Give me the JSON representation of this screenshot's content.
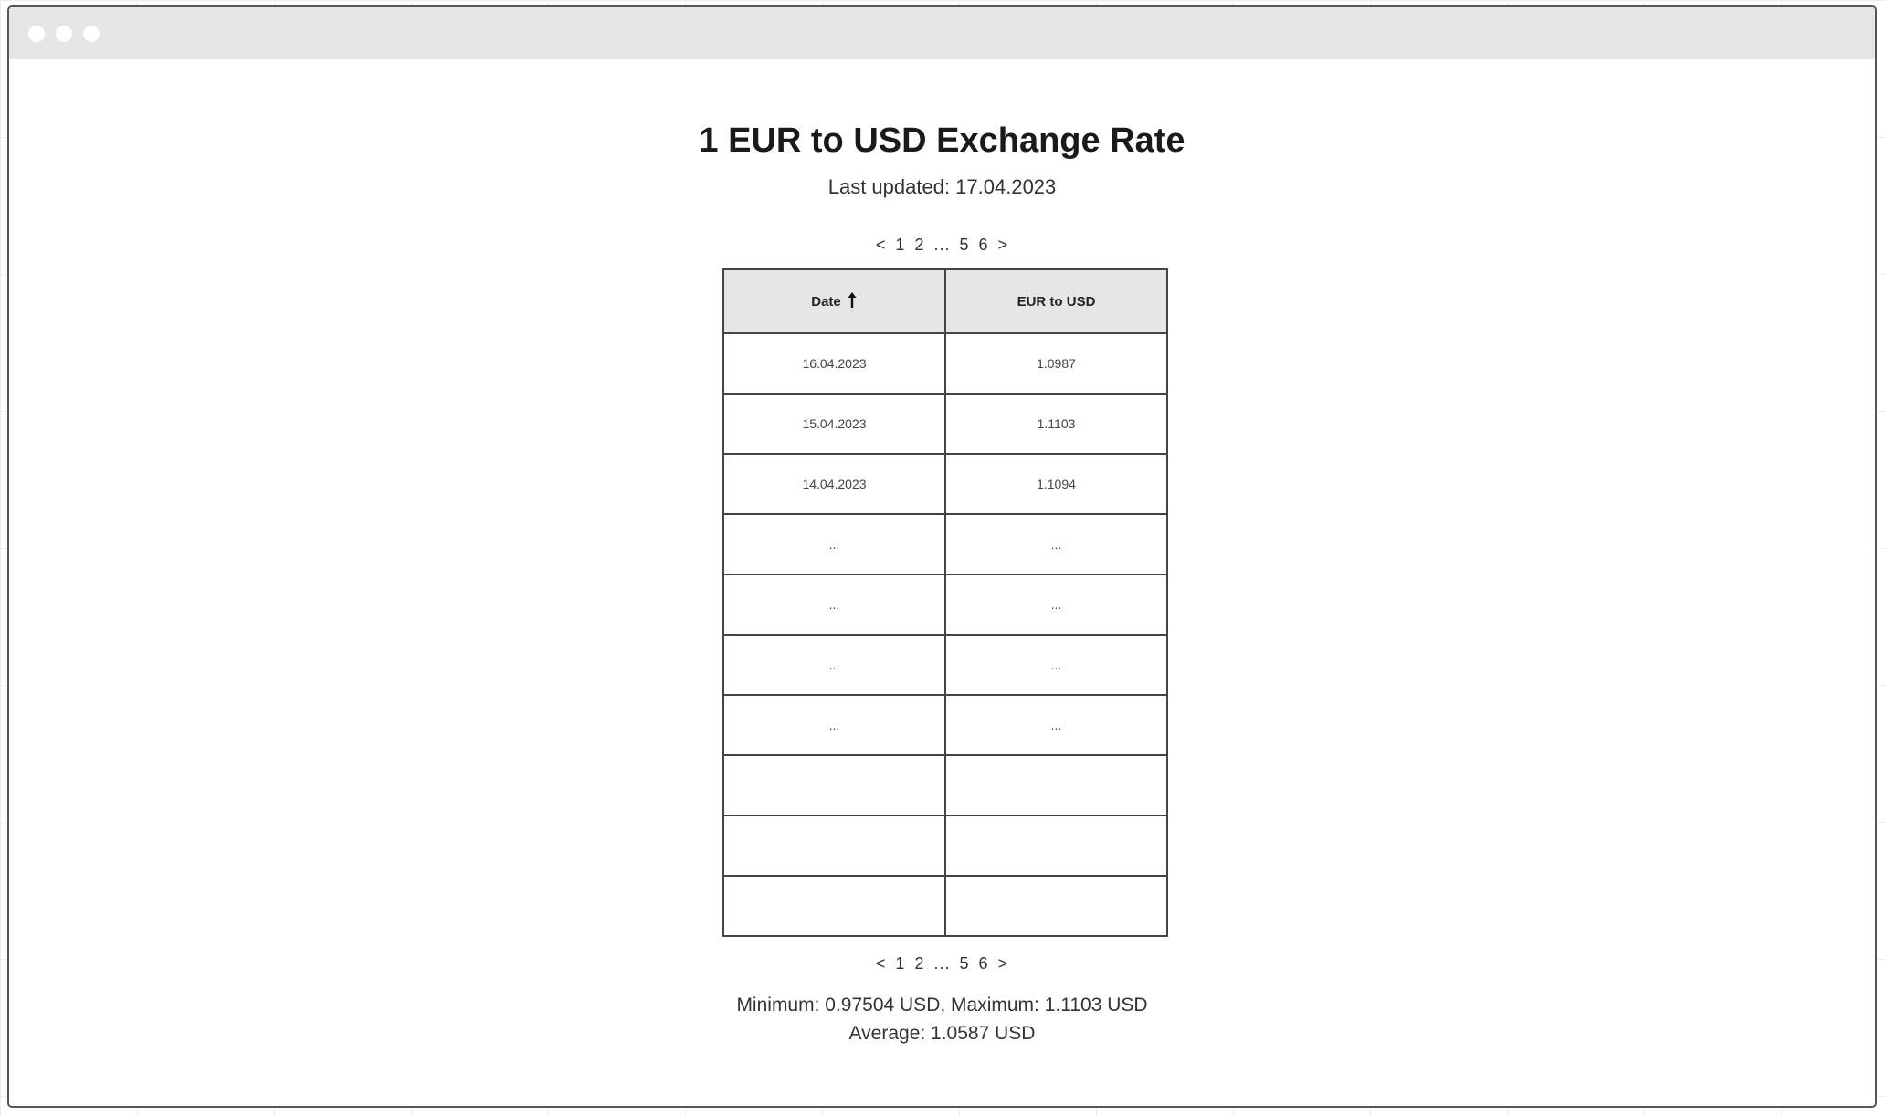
{
  "page": {
    "title": "1 EUR to USD Exchange Rate",
    "last_updated": "Last updated: 17.04.2023"
  },
  "pagination": {
    "prev": "<",
    "pages": [
      "1",
      "2",
      "...",
      "5",
      "6"
    ],
    "next": ">"
  },
  "table": {
    "headers": [
      "Date",
      "EUR to USD"
    ],
    "sort_icon": "arrow-up-icon",
    "rows": [
      [
        "16.04.2023",
        "1.0987"
      ],
      [
        "15.04.2023",
        "1.1103"
      ],
      [
        "14.04.2023",
        "1.1094"
      ],
      [
        "...",
        "..."
      ],
      [
        "...",
        "..."
      ],
      [
        "...",
        "..."
      ],
      [
        "...",
        "..."
      ],
      [
        "",
        ""
      ],
      [
        "",
        ""
      ],
      [
        "",
        ""
      ]
    ]
  },
  "stats": {
    "line1": "Minimum: 0.97504 USD, Maximum: 1.1103 USD",
    "line2": "Average: 1.0587 USD"
  }
}
